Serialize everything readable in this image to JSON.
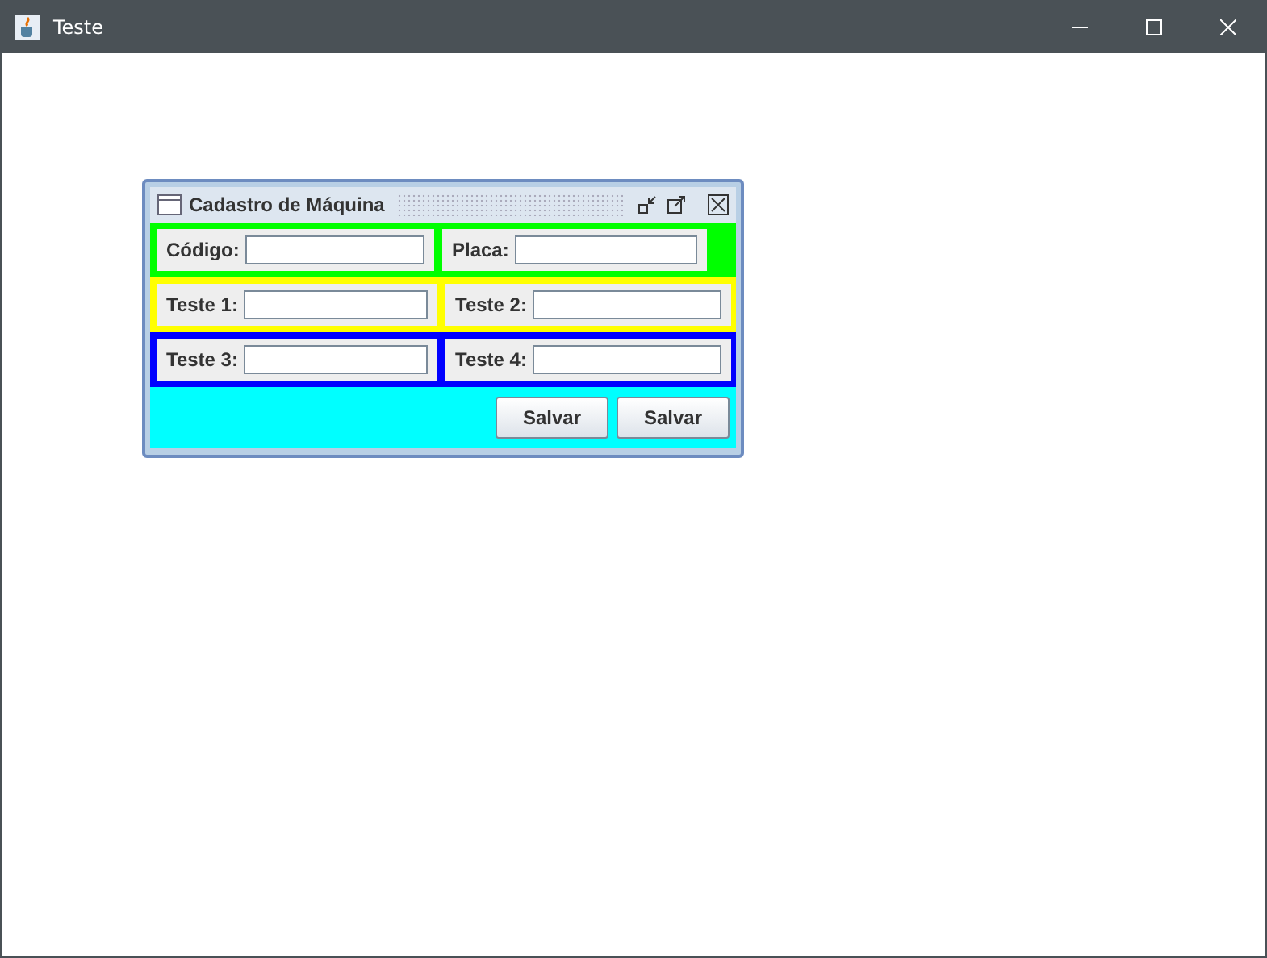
{
  "window": {
    "title": "Teste"
  },
  "internal_frame": {
    "title": "Cadastro de Máquina"
  },
  "rows": [
    {
      "color": "#00ff00",
      "fields": [
        {
          "label": "Código:"
        },
        {
          "label": "Placa:"
        }
      ]
    },
    {
      "color": "#ffff00",
      "fields": [
        {
          "label": "Teste 1:"
        },
        {
          "label": "Teste 2:"
        }
      ]
    },
    {
      "color": "#0000ff",
      "fields": [
        {
          "label": "Teste 3:"
        },
        {
          "label": "Teste 4:"
        }
      ]
    }
  ],
  "button_bar": {
    "color": "#00ffff",
    "buttons": [
      "Salvar",
      "Salvar"
    ]
  }
}
